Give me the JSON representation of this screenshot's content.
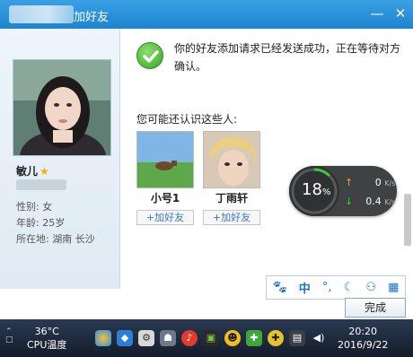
{
  "window": {
    "title": "加好友"
  },
  "profile": {
    "name": "敏儿",
    "gender": "性别: 女",
    "age": "年龄: 25岁",
    "location": "所在地: 湖南  长沙"
  },
  "message": "你的好友添加请求已经发送成功，正在等待对方确认。",
  "suggest_title": "您可能还认识这些人:",
  "suggestions": [
    {
      "name": "小号1",
      "button": "+加好友"
    },
    {
      "name": "丁雨轩",
      "button": "+加好友"
    }
  ],
  "speed_widget": {
    "percent": "18",
    "unit": "%",
    "upload": "0",
    "download": "0.4",
    "rate_unit": "K/s"
  },
  "ime_toolbar": {
    "icons": [
      "paw-icon",
      "zhong-icon",
      "punct-icon",
      "moon-icon",
      "user-icon",
      "grid-icon"
    ],
    "labels": [
      "🐾",
      "中",
      "°,",
      "☾",
      "⚇",
      "▦"
    ]
  },
  "done_button": "完成",
  "taskbar": {
    "temperature": "36°C",
    "cpu_label": "CPU温度",
    "time": "20:20",
    "date": "2016/9/22"
  },
  "colors": {
    "title_bar": "#2b93dc",
    "accent": "#1e6fd1",
    "success": "#38a32a"
  }
}
